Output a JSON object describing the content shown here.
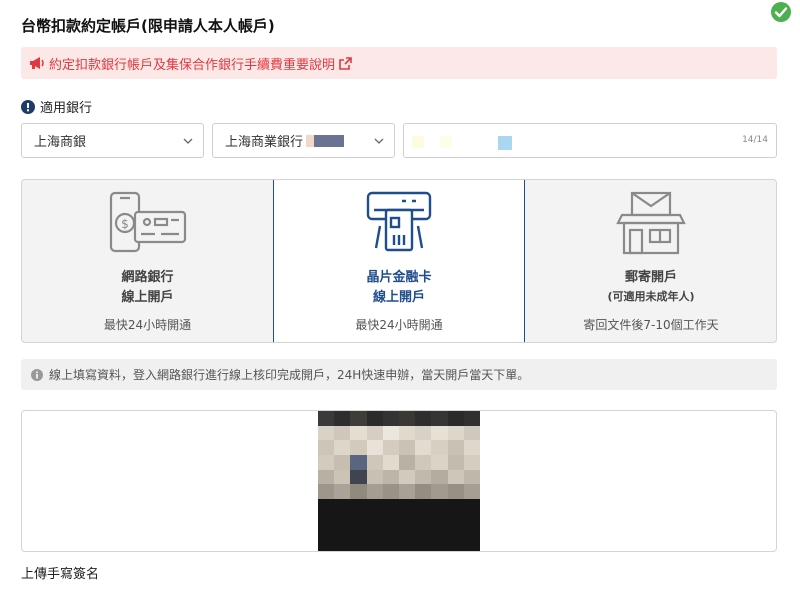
{
  "title": "台幣扣款約定帳戶(限申請人本人帳戶)",
  "notice": {
    "text": "約定扣款銀行帳戶及集保合作銀行手續費重要說明",
    "color": "#e2383f"
  },
  "bank_section": {
    "label": "適用銀行",
    "bank_select": "上海商銀",
    "branch_select": "上海商業銀行",
    "account_counter": "14/14"
  },
  "options": [
    {
      "icon": "online-banking-icon",
      "title_line1": "網路銀行",
      "title_line2": "線上開戶",
      "subtitle": "最快24小時開通",
      "selected": false
    },
    {
      "icon": "chip-card-atm-icon",
      "title_line1": "晶片金融卡",
      "title_line2": "線上開戶",
      "subtitle": "最快24小時開通",
      "selected": true
    },
    {
      "icon": "post-office-icon",
      "title_line1": "郵寄開戶",
      "title_line2": "(可適用未成年人)",
      "subtitle": "寄回文件後7-10個工作天",
      "selected": false
    }
  ],
  "hint": "線上填寫資料，登入網路銀行進行線上核印完成開戶，24H快速申辦，當天開戶當天下單。",
  "upload_label": "上傳手寫簽名",
  "colors": {
    "accent": "#1f4e8c",
    "success": "#4caf50"
  }
}
